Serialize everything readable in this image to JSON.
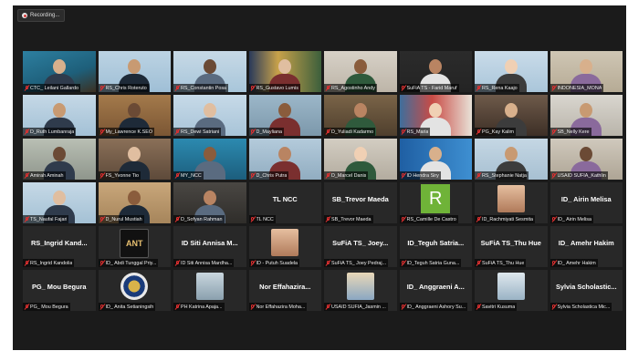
{
  "app": {
    "recording_label": "Recording..."
  },
  "colors": {
    "stage_bg": "#1b1b1b",
    "tile_bg": "#282828",
    "muted_icon": "#e03030",
    "avatar_green": "#6fb338"
  },
  "participants": [
    {
      "name": "CTC_ Leilani Gallardo",
      "kind": "video"
    },
    {
      "name": "RS_Chris Roteruto",
      "kind": "video"
    },
    {
      "name": "RS_Constantin Posa",
      "kind": "video"
    },
    {
      "name": "RS_Gustavo Lumis",
      "kind": "video"
    },
    {
      "name": "RS_Agostinho Andy",
      "kind": "video"
    },
    {
      "name": "SuFiA TS - Farid Maruf",
      "kind": "video"
    },
    {
      "name": "RS_Rena Kaajo",
      "kind": "video"
    },
    {
      "name": "INDONESIA_MONA",
      "kind": "video"
    },
    {
      "name": "D_Ruth Lumbanraja",
      "kind": "video"
    },
    {
      "name": "My_Lawrence K.SEO",
      "kind": "video"
    },
    {
      "name": "RS_Dewi Satriani",
      "kind": "video"
    },
    {
      "name": "D_Mayliana",
      "kind": "video"
    },
    {
      "name": "D_Yuliadi Kadarmo",
      "kind": "video"
    },
    {
      "name": "RS_Maria",
      "kind": "video"
    },
    {
      "name": "PG_Kay Kalim",
      "kind": "video"
    },
    {
      "name": "SB_Nelly Kere",
      "kind": "video"
    },
    {
      "name": "Amirah Aminah",
      "kind": "video"
    },
    {
      "name": "FS_Yvonne Tio",
      "kind": "video"
    },
    {
      "name": "MY_NCC",
      "kind": "video"
    },
    {
      "name": "D_Chris Putra",
      "kind": "video"
    },
    {
      "name": "D_Marcel Danis",
      "kind": "video"
    },
    {
      "name": "ID Hendra Siry",
      "kind": "video"
    },
    {
      "name": "RS_Stephanie Natja",
      "kind": "video"
    },
    {
      "name": "USAID SUFIA_Kathlin",
      "kind": "video"
    },
    {
      "name": "TS_Naufal Fajari",
      "kind": "video"
    },
    {
      "name": "D_Nurul Mustiah",
      "kind": "video"
    },
    {
      "name": "D_Sofyan Rahman",
      "kind": "video"
    },
    {
      "name": "TL NCC",
      "kind": "text",
      "big": "TL NCC"
    },
    {
      "name": "SB_Trevor Maeda",
      "kind": "text",
      "big": "SB_Trevor Maeda"
    },
    {
      "name": "RS_Camille De Castro",
      "kind": "letter",
      "letter": "R"
    },
    {
      "name": "ID_Rachmiyati Sesmita",
      "kind": "image"
    },
    {
      "name": "ID_ Airin Melisa",
      "kind": "text",
      "big": "ID_ Airin Melisa"
    },
    {
      "name": "RS_Ingrid Kandolia",
      "kind": "text",
      "big": "RS_Ingrid Kand..."
    },
    {
      "name": "ID_ Abdi Tunggal Priy...",
      "kind": "image",
      "badge": "ANT"
    },
    {
      "name": "ID Siti Annisa Mardha...",
      "kind": "text",
      "big": "ID Siti Annisa M..."
    },
    {
      "name": "ID - Putuh Suadela",
      "kind": "image"
    },
    {
      "name": "SuFiA TS_ Joey Pedraj...",
      "kind": "text",
      "big": "SuFiA TS_ Joey..."
    },
    {
      "name": "ID_Teguh Satria Guna...",
      "kind": "text",
      "big": "ID_Teguh Satria..."
    },
    {
      "name": "SuFiA TS_Thu Hue",
      "kind": "text",
      "big": "SuFiA TS_Thu Hue"
    },
    {
      "name": "ID_ Amehr Hakim",
      "kind": "text",
      "big": "ID_ Amehr Hakim"
    },
    {
      "name": "PG_ Mou Begura",
      "kind": "text",
      "big": "PG_ Mou Begura"
    },
    {
      "name": "ID_ Anita Setianingsih",
      "kind": "image",
      "badge": "emblem"
    },
    {
      "name": "PH Katrina Apaja...",
      "kind": "image"
    },
    {
      "name": "Nor Effahazira Moha...",
      "kind": "text",
      "big": "Nor Effahazira..."
    },
    {
      "name": "USAID SUFIA_Jasmin ...",
      "kind": "image"
    },
    {
      "name": "ID_ Anggraeni Ashory Su...",
      "kind": "text",
      "big": "ID_ Anggraeni A..."
    },
    {
      "name": "Savitri Kusuma",
      "kind": "image"
    },
    {
      "name": "Sylvia Scholastica Mic...",
      "kind": "text",
      "big": "Sylvia Scholastic..."
    }
  ]
}
